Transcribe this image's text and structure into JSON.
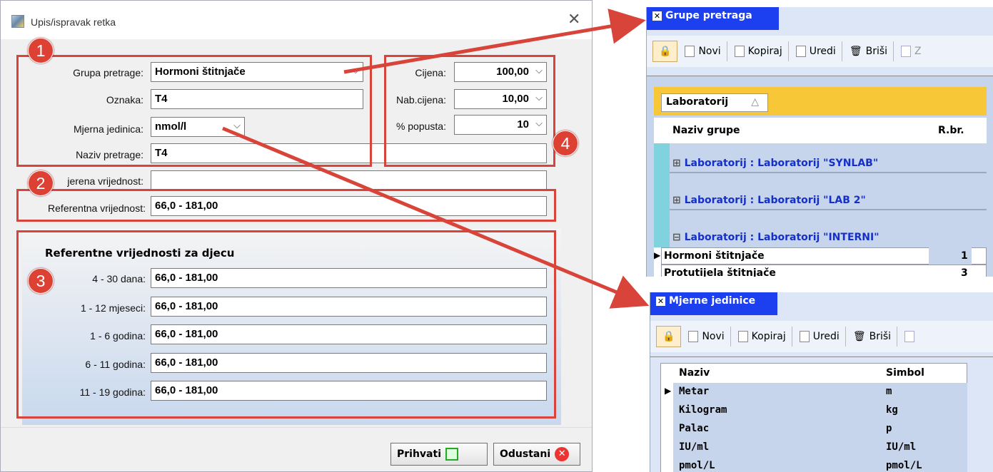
{
  "dialog": {
    "title": "Upis/ispravak retka",
    "close": "✕",
    "fields": {
      "grupa_label": "Grupa pretrage:",
      "grupa_value": "Hormoni štitnjače",
      "oznaka_label": "Oznaka:",
      "oznaka_value": "T4",
      "mj_label": "Mjerna jedinica:",
      "mj_value": "nmol/l",
      "naziv_label": "Naziv pretrage:",
      "naziv_value": "T4",
      "izmjerena_label": "jerena vrijednost:",
      "izmjerena_value": "",
      "ref_label": "Referentna vrijednost:",
      "ref_value": "66,0 - 181,00"
    },
    "prices": {
      "cijena_label": "Cijena:",
      "cijena_value": "100,00",
      "nab_label": "Nab.cijena:",
      "nab_value": "10,00",
      "popust_label": "% popusta:",
      "popust_value": "10"
    },
    "kids": {
      "heading": "Referentne vrijednosti za djecu",
      "rows": [
        {
          "label": "4 - 30 dana:",
          "value": "66,0 - 181,00"
        },
        {
          "label": "1 - 12  mjeseci:",
          "value": "66,0 - 181,00"
        },
        {
          "label": "1 - 6 godina:",
          "value": "66,0 - 181,00"
        },
        {
          "label": "6 - 11 godina:",
          "value": "66,0 - 181,00"
        },
        {
          "label": "11 - 19 godina:",
          "value": "66,0 - 181,00"
        }
      ]
    },
    "buttons": {
      "accept": "Prihvati",
      "cancel": "Odustani"
    },
    "badges": [
      "1",
      "2",
      "3",
      "4"
    ]
  },
  "panel1": {
    "tab": "Grupe pretraga",
    "toolbar": [
      "Novi",
      "Kopiraj",
      "Uredi",
      "Briši",
      "Z"
    ],
    "group_by": "Laboratorij",
    "col_naziv": "Naziv grupe",
    "col_rbr": "R.br.",
    "groups": [
      "Laboratorij : Laboratorij \"SYNLAB\"",
      "Laboratorij : Laboratorij \"LAB 2\"",
      "Laboratorij : Laboratorij \"INTERNI\""
    ],
    "rows": [
      {
        "naziv": "Hormoni štitnjače",
        "rbr": "1"
      },
      {
        "naziv": "Protutijela štitnjače",
        "rbr": "3"
      }
    ]
  },
  "panel2": {
    "tab": "Mjerne jedinice",
    "toolbar": [
      "Novi",
      "Kopiraj",
      "Uredi",
      "Briši"
    ],
    "col_naziv": "Naziv",
    "col_simbol": "Simbol",
    "rows": [
      {
        "naziv": "Metar",
        "simbol": "m"
      },
      {
        "naziv": "Kilogram",
        "simbol": "kg"
      },
      {
        "naziv": "Palac",
        "simbol": "p"
      },
      {
        "naziv": "IU/ml",
        "simbol": "IU/ml"
      },
      {
        "naziv": "pmol/L",
        "simbol": "pmol/L"
      }
    ]
  },
  "colors": {
    "annotation": "#d9443a",
    "tab": "#1c3ff0",
    "group_text": "#1530c8"
  }
}
